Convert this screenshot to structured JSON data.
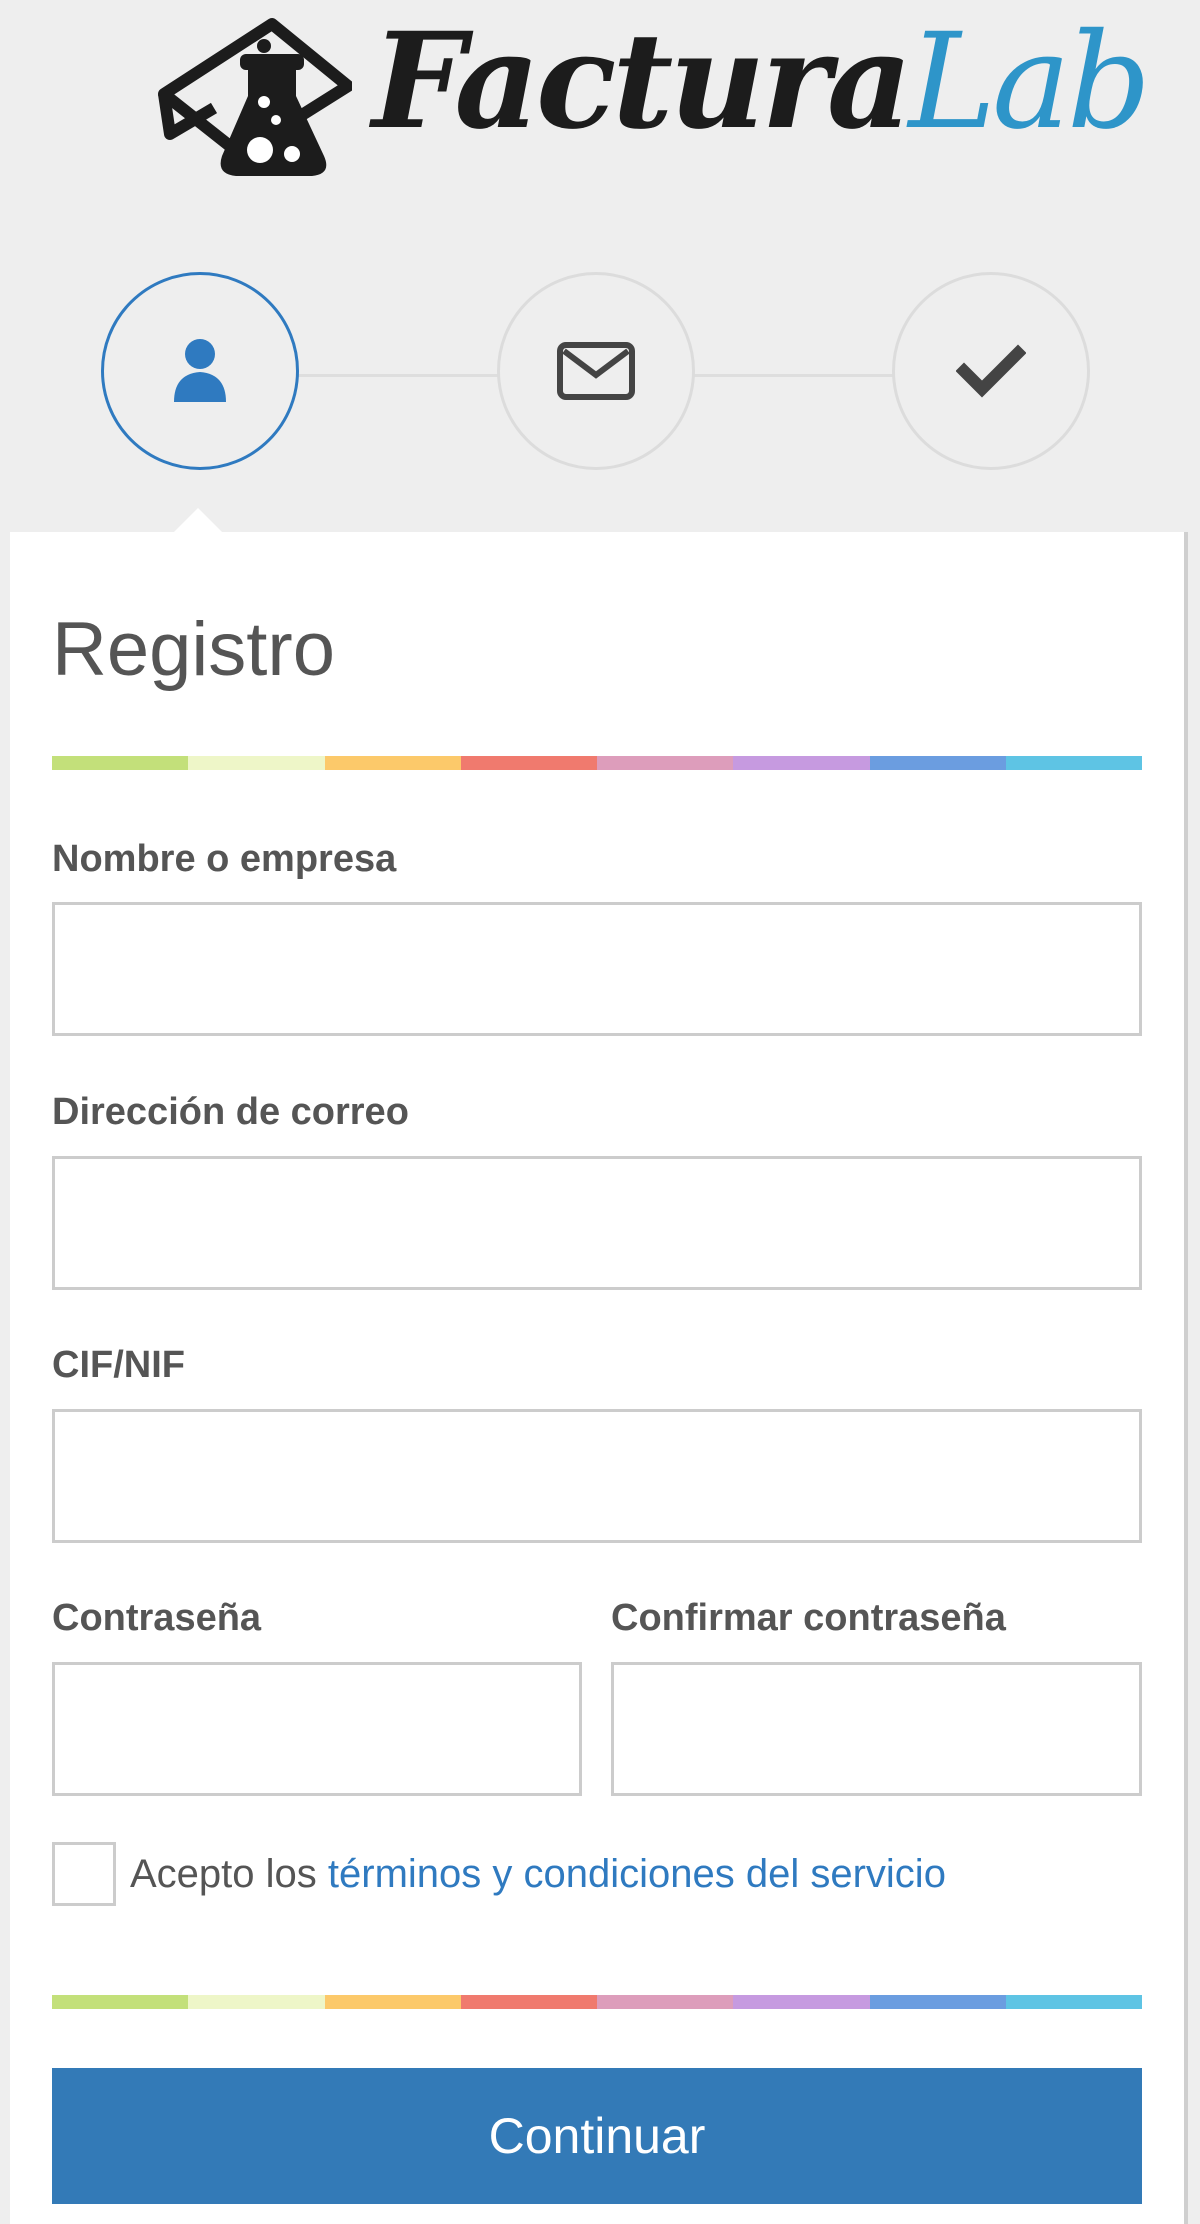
{
  "logo": {
    "text_dark": "Factura",
    "text_blue": "Lab"
  },
  "steps": [
    {
      "icon": "user-icon",
      "active": true
    },
    {
      "icon": "envelope-icon",
      "active": false
    },
    {
      "icon": "checkmark-icon",
      "active": false
    }
  ],
  "colors": {
    "accent": "#2f7ac0",
    "button": "#337ab7",
    "logo_blue": "#2e95c9",
    "stripe": [
      "#c3e07a",
      "#eef6c8",
      "#fcc96a",
      "#f07a6e",
      "#dd9dbb",
      "#c69ae0",
      "#6b9de0",
      "#5ec4e4"
    ]
  },
  "form": {
    "title": "Registro",
    "name_label": "Nombre o empresa",
    "email_label": "Dirección de correo",
    "cif_label": "CIF/NIF",
    "password_label": "Contraseña",
    "confirm_label": "Confirmar contraseña",
    "name_value": "",
    "email_value": "",
    "cif_value": "",
    "password_value": "",
    "confirm_value": "",
    "terms_prefix": "Acepto los ",
    "terms_link": "términos y condiciones del servicio",
    "terms_checked": false,
    "submit_label": "Continuar"
  }
}
